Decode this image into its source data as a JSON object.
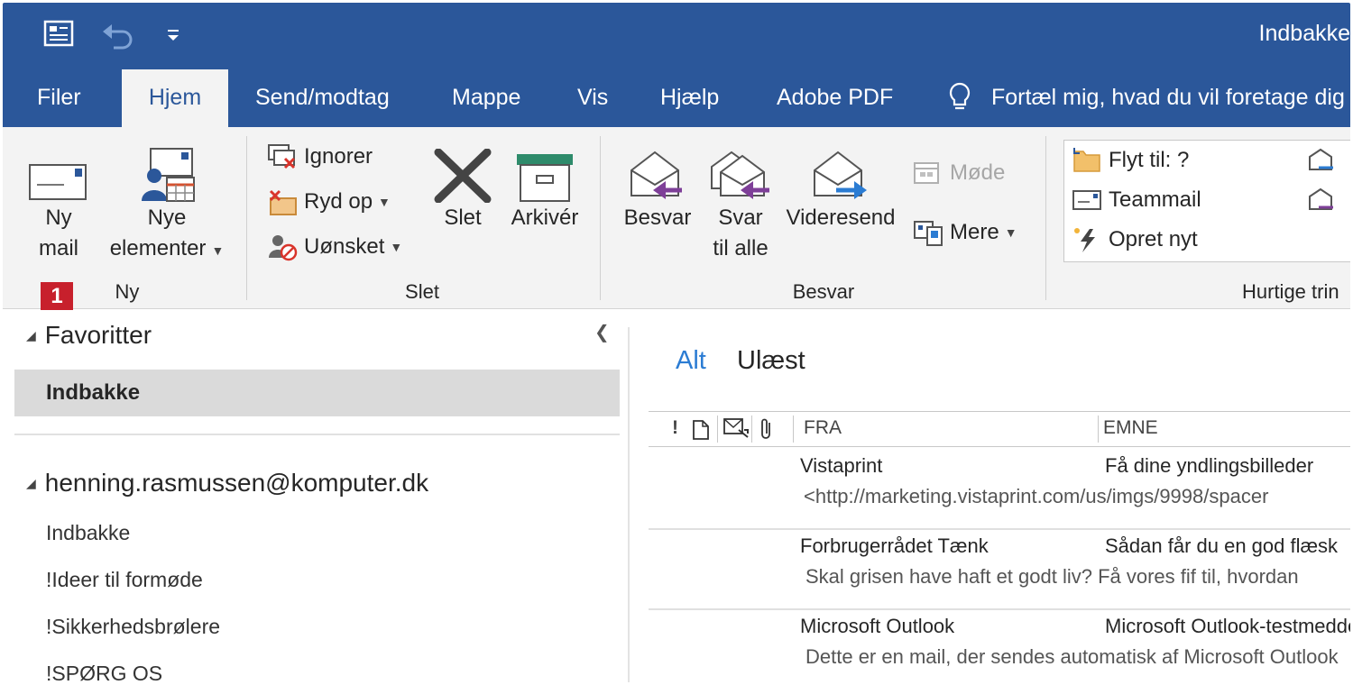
{
  "window": {
    "title": "Indbakke"
  },
  "quick_access": {
    "items": [
      "send-receive-icon",
      "undo-icon",
      "customize-qat-icon"
    ]
  },
  "tabs": [
    {
      "label": "Filer"
    },
    {
      "label": "Hjem"
    },
    {
      "label": "Send/modtag"
    },
    {
      "label": "Mappe"
    },
    {
      "label": "Vis"
    },
    {
      "label": "Hjælp"
    },
    {
      "label": "Adobe PDF"
    }
  ],
  "tellme": {
    "text": "Fortæl mig, hvad du vil foretage dig"
  },
  "ribbon": {
    "groups": {
      "ny": {
        "label": "Ny",
        "new_mail": [
          "Ny",
          "mail"
        ],
        "new_items": [
          "Nye",
          "elementer"
        ],
        "badge": "1"
      },
      "slet": {
        "label": "Slet",
        "ignore": "Ignorer",
        "cleanup": "Ryd op",
        "junk": "Uønsket",
        "delete": "Slet",
        "archive": "Arkivér"
      },
      "besvar": {
        "label": "Besvar",
        "reply": "Besvar",
        "reply_all": [
          "Svar",
          "til alle"
        ],
        "forward": "Videresend",
        "meeting": "Møde",
        "more": "Mere"
      },
      "quicksteps": {
        "label": "Hurtige trin",
        "move_to": "Flyt til: ?",
        "team_mail": "Teammail",
        "create_new": "Opret nyt"
      }
    }
  },
  "folders": {
    "favorites_header": "Favoritter",
    "favorites": [
      {
        "label": "Indbakke",
        "selected": true
      }
    ],
    "account": "henning.rasmussen@komputer.dk",
    "items": [
      "Indbakke",
      "!Ideer til formøde",
      "!Sikkerhedsbrølere",
      "!SPØRG OS"
    ]
  },
  "message_list": {
    "filters": {
      "all": "Alt",
      "unread": "Ulæst"
    },
    "columns": {
      "importance": "!",
      "from": "FRA",
      "subject": "EMNE"
    },
    "messages": [
      {
        "from": "Vistaprint",
        "subject": "Få dine yndlingsbilleder",
        "preview": "<http://marketing.vistaprint.com/us/imgs/9998/spacer"
      },
      {
        "from": "Forbrugerrådet Tænk",
        "subject": "Sådan får du en god flæsk",
        "preview": "Skal grisen have haft et godt liv? Få vores fif til, hvordan"
      },
      {
        "from": "Microsoft Outlook",
        "subject": "Microsoft Outlook-testmeddelelse",
        "preview": "Dette er en mail, der sendes automatisk af Microsoft Outlook"
      }
    ]
  },
  "colors": {
    "brand": "#2b579a",
    "ribbon_bg": "#f3f3f3",
    "accent": "#2b7cd3",
    "badge": "#c7202c"
  }
}
